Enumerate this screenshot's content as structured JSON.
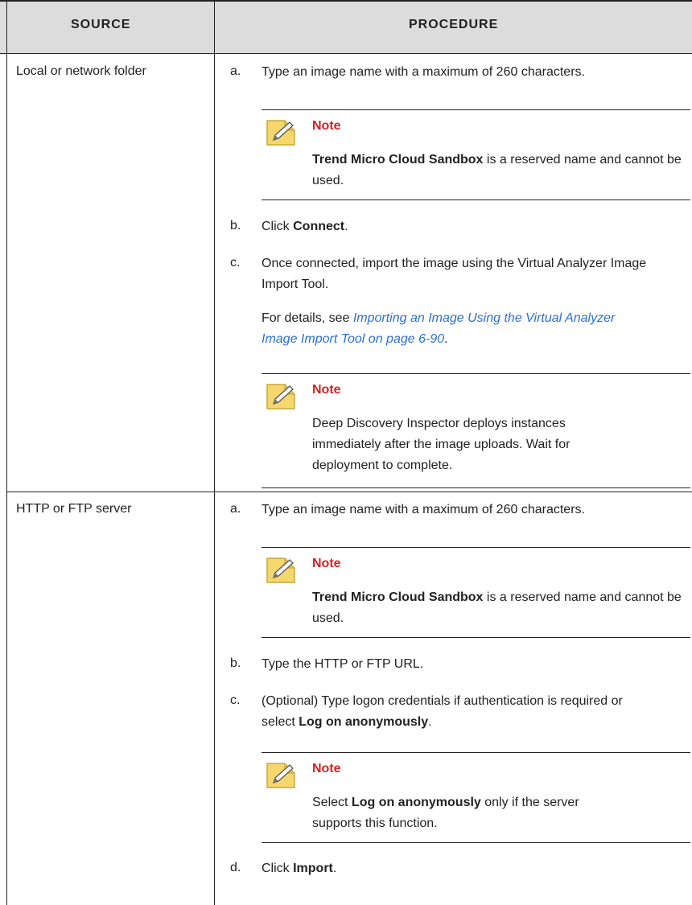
{
  "header": {
    "source": "Source",
    "procedure": "Procedure"
  },
  "rows": [
    {
      "source": "Local or network folder",
      "steps": {
        "a": {
          "letter": "a.",
          "text": "Type an image name with a maximum of 260 characters."
        },
        "note1": {
          "title": "Note",
          "bold": "Trend Micro Cloud Sandbox",
          "text": " is a reserved name and cannot be used."
        },
        "b": {
          "letter": "b.",
          "pre": "Click ",
          "bold": "Connect",
          "post": "."
        },
        "c": {
          "letter": "c.",
          "text": "Once connected, import the image using the Virtual Analyzer Image Import Tool."
        },
        "c_details": {
          "pre": "For details, see ",
          "link": "Importing an Image Using the Virtual Analyzer Image Import Tool on page 6-90",
          "post": "."
        },
        "note2": {
          "title": "Note",
          "text": "Deep Discovery Inspector deploys instances immediately after the image uploads. Wait for deployment to complete."
        }
      }
    },
    {
      "source": "HTTP or FTP server",
      "steps": {
        "a": {
          "letter": "a.",
          "text": "Type an image name with a maximum of 260 characters."
        },
        "note1": {
          "title": "Note",
          "bold": "Trend Micro Cloud Sandbox",
          "text": " is a reserved name and cannot be used."
        },
        "b": {
          "letter": "b.",
          "text": "Type the HTTP or FTP URL."
        },
        "c": {
          "letter": "c.",
          "pre": "(Optional) Type logon credentials if authentication is required or select ",
          "bold": "Log on anonymously",
          "post": "."
        },
        "note2": {
          "title": "Note",
          "pre": "Select ",
          "bold": "Log on anonymously",
          "post": " only if the server supports this function."
        },
        "d": {
          "letter": "d.",
          "pre": "Click ",
          "bold": "Import",
          "post": "."
        }
      }
    }
  ],
  "colors": {
    "note_title": "#d92020",
    "link": "#2a6fd6",
    "header_bg": "#dcdcdc",
    "note_icon_bg": "#f5d76e"
  }
}
